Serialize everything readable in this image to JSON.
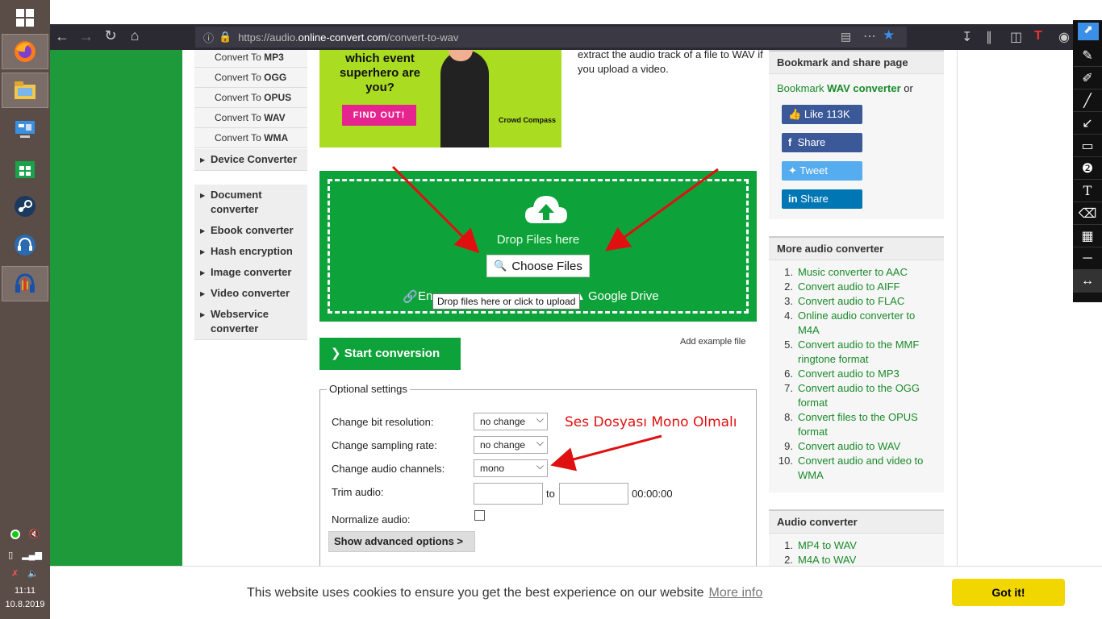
{
  "taskbar": {
    "start_icon": "windows-logo-icon",
    "apps": [
      "firefox-icon",
      "file-explorer-icon",
      "control-panel-icon",
      "store-icon",
      "steam-icon",
      "headset-icon",
      "audacity-icon"
    ],
    "clock_time": "11:11",
    "clock_date": "10.8.2019"
  },
  "browser": {
    "url_prefix": "https://audio.",
    "url_host": "online-convert.com",
    "url_path": "/convert-to-wav",
    "tools_glyph": "T"
  },
  "left_menu": {
    "sub_items": [
      {
        "prefix": "Convert To ",
        "fmt": "MP3"
      },
      {
        "prefix": "Convert To ",
        "fmt": "OGG"
      },
      {
        "prefix": "Convert To ",
        "fmt": "OPUS"
      },
      {
        "prefix": "Convert To ",
        "fmt": "WAV"
      },
      {
        "prefix": "Convert To ",
        "fmt": "WMA"
      }
    ],
    "categories": [
      "Device Converter",
      "Document converter",
      "Ebook converter",
      "Hash encryption",
      "Image converter",
      "Video converter",
      "Webservice converter"
    ]
  },
  "ad": {
    "headline": "which event superhero are you?",
    "button": "FIND OUT!",
    "logo": "Crowd Compass"
  },
  "intro_text": "extract the audio track of a file to WAV if you upload a video.",
  "dropzone": {
    "drop_text": "Drop Files here",
    "choose_label": "Choose Files",
    "url_source": "En",
    "drive_source": "Google Drive",
    "tooltip": "Drop files here or click to upload"
  },
  "start_conversion": "Start conversion",
  "add_example": "Add example file",
  "optional": {
    "legend": "Optional settings",
    "bit_label": "Change bit resolution:",
    "bit_value": "no change",
    "sampling_label": "Change sampling rate:",
    "sampling_value": "no change",
    "channels_label": "Change audio channels:",
    "channels_value": "mono",
    "trim_label": "Trim audio:",
    "trim_to": "to",
    "trim_time": "00:00:00",
    "normalize_label": "Normalize audio:",
    "advanced": "Show advanced options >"
  },
  "annotation_text": "Ses Dosyası Mono Olmalı",
  "bookmark": {
    "head": "Bookmark and share page",
    "line_prefix": "Bookmark ",
    "line_bold": "WAV converter",
    "line_suffix": " or",
    "like": "Like 113K",
    "fb_share": "Share",
    "tweet": "Tweet",
    "in_share": "Share"
  },
  "more_audio": {
    "head": "More audio converter",
    "items": [
      "Music converter to AAC",
      "Convert audio to AIFF",
      "Convert audio to FLAC",
      "Online audio converter to M4A",
      "Convert audio to the MMF ringtone format",
      "Convert audio to MP3",
      "Convert audio to the OGG format",
      "Convert files to the OPUS format",
      "Convert audio to WAV",
      "Convert audio and video to WMA"
    ]
  },
  "audio_converter": {
    "head": "Audio converter",
    "items": [
      "MP4 to WAV",
      "M4A to WAV"
    ]
  },
  "cookie": {
    "text": "This website uses cookies to ensure you get the best experience on our website",
    "more": "More info",
    "button": "Got it!"
  },
  "colors": {
    "accent_green": "#0ea23a",
    "annotation_red": "#e01010",
    "cookie_yellow": "#f1d600"
  }
}
